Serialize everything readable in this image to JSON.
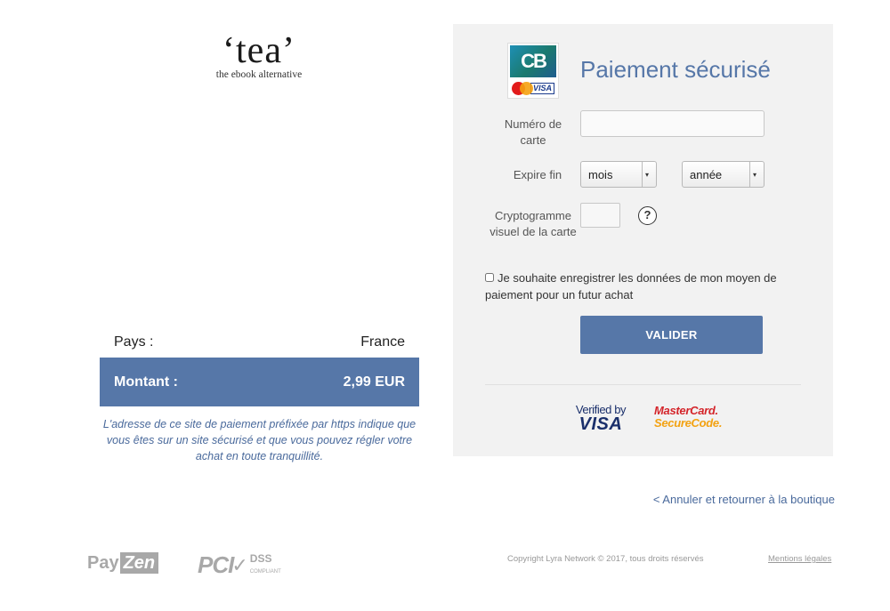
{
  "merchant": {
    "logo_word": "‘tea’",
    "logo_tagline": "the ebook alternative"
  },
  "summary": {
    "country_label": "Pays :",
    "country_value": "France",
    "amount_label": "Montant :",
    "amount_value": "2,99 EUR",
    "secure_note": "L'adresse de ce site de paiement préfixée par https indique que vous êtes sur un site sécurisé et que vous pouvez régler votre achat en toute tranquillité."
  },
  "form": {
    "title": "Paiement sécurisé",
    "card_brand": {
      "cb_text": "CB",
      "visa_text": "VISA"
    },
    "card_number_label": "Numéro de carte",
    "card_number_value": "",
    "expiry_label": "Expire fin",
    "month_selected": "mois",
    "year_selected": "année",
    "cvv_label": "Cryptogramme visuel de la carte",
    "cvv_value": "",
    "help_symbol": "?",
    "save_checkbox_label": "Je souhaite enregistrer les données de mon moyen de paiement pour un futur achat",
    "save_checked": false,
    "submit_label": "VALIDER"
  },
  "security_badges": {
    "vbv_line1": "Verified by",
    "vbv_line2": "VISA",
    "mc_line1": "MasterCard.",
    "mc_line2": "SecureCode."
  },
  "cancel_link": "< Annuler et retourner à la boutique",
  "footer": {
    "payzen_pay": "Pay",
    "payzen_zen": "Zen",
    "pci_mark": "PCI",
    "pci_dss": "DSS",
    "pci_compliant": "COMPLIANT",
    "copyright": "Copyright Lyra Network © 2017, tous droits réservés",
    "legal_link": "Mentions légales"
  },
  "colors": {
    "accent": "#5677a8",
    "panel_bg": "#f2f2f2",
    "link": "#4a6a9c"
  }
}
